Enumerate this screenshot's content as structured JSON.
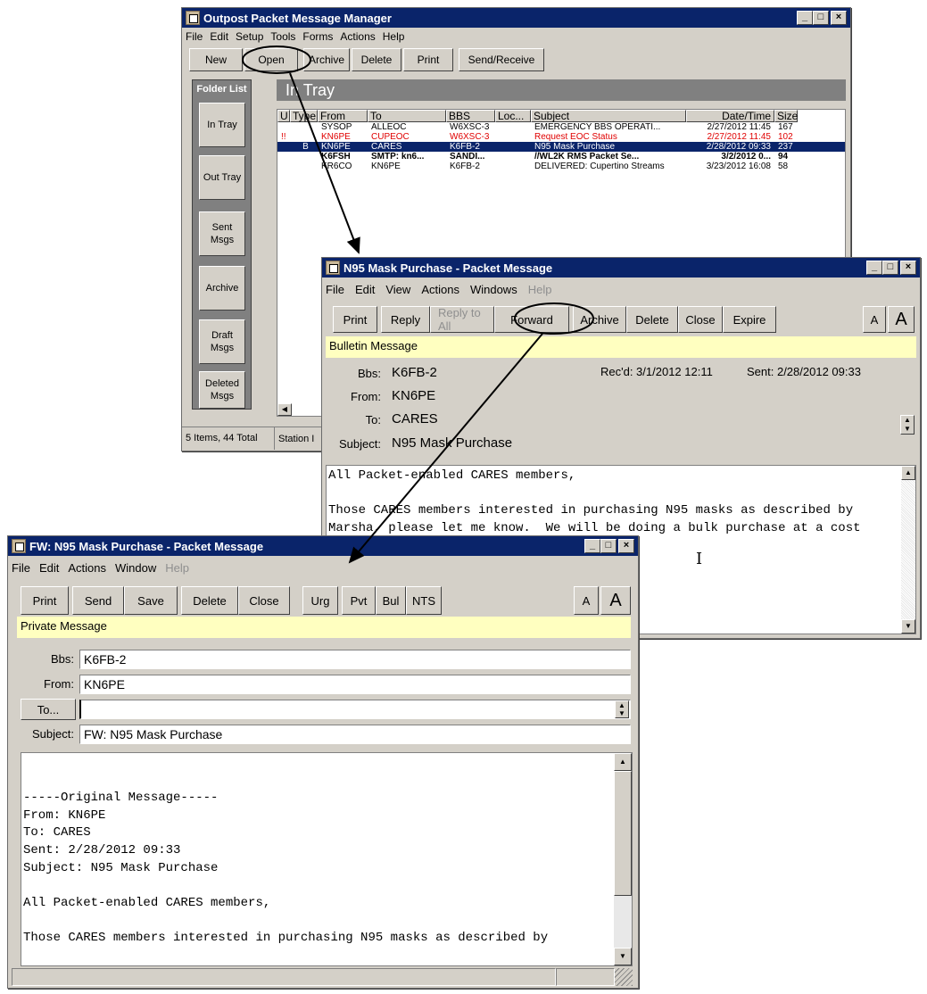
{
  "mgr": {
    "title": "Outpost Packet Message Manager",
    "menu": [
      "File",
      "Edit",
      "Setup",
      "Tools",
      "Forms",
      "Actions",
      "Help"
    ],
    "toolbar": [
      "New",
      "Open",
      "Archive",
      "Delete",
      "Print",
      "Send/Receive"
    ],
    "folder_list_label": "Folder List",
    "folders": [
      "In Tray",
      "Out Tray",
      "Sent Msgs",
      "Archive",
      "Draft Msgs",
      "Deleted Msgs"
    ],
    "tray_title": "In Tray",
    "columns": [
      "U",
      "Type",
      "From",
      "To",
      "BBS",
      "Loc...",
      "Subject",
      "Date/Time",
      "Size"
    ],
    "rows": [
      {
        "u": "",
        "type": "",
        "from": "SYSOP",
        "to": "ALLEOC",
        "bbs": "W6XSC-3",
        "subject": "EMERGENCY BBS OPERATI...",
        "date": "2/27/2012 11:45",
        "size": "167",
        "style": "normal"
      },
      {
        "u": "!!",
        "type": "",
        "from": "KN6PE",
        "to": "CUPEOC",
        "bbs": "W6XSC-3",
        "subject": "Request EOC Status",
        "date": "2/27/2012 11:45",
        "size": "102",
        "style": "red"
      },
      {
        "u": "",
        "type": "B",
        "from": "KN6PE",
        "to": "CARES",
        "bbs": "K6FB-2",
        "subject": "N95 Mask Purchase",
        "date": "2/28/2012 09:33",
        "size": "237",
        "style": "selected"
      },
      {
        "u": "",
        "type": "",
        "from": "K6FSH",
        "to": "SMTP: kn6...",
        "bbs": "SANDI...",
        "subject": "//WL2K RMS Packet Se...",
        "date": "3/2/2012 0...",
        "size": "94",
        "style": "bold"
      },
      {
        "u": "",
        "type": "",
        "from": "KR6CO",
        "to": "KN6PE",
        "bbs": "K6FB-2",
        "subject": "DELIVERED: Cupertino Streams",
        "date": "3/23/2012 16:08",
        "size": "58",
        "style": "normal"
      }
    ],
    "status_items": "5 Items, 44 Total",
    "status_station": "Station I"
  },
  "msg": {
    "title": "N95 Mask Purchase - Packet Message",
    "menu": [
      "File",
      "Edit",
      "View",
      "Actions",
      "Windows"
    ],
    "menu_help": "Help",
    "toolbar": [
      "Print",
      "Reply",
      "Reply to All",
      "Forward",
      "Archive",
      "Delete",
      "Close",
      "Expire"
    ],
    "font_small": "A",
    "font_large": "A",
    "banner": "Bulletin Message",
    "bbs_label": "Bbs:",
    "bbs": "K6FB-2",
    "from_label": "From:",
    "from": "KN6PE",
    "to_label": "To:",
    "to": "CARES",
    "subject_label": "Subject:",
    "subject": "N95 Mask Purchase",
    "recd": "Rec'd:  3/1/2012 12:11",
    "sent": "Sent:  2/28/2012 09:33",
    "body": "All Packet-enabled CARES members,\n\nThose CARES members interested in purchasing N95 masks as described by\nMarsha, please let me know.  We will be doing a bulk purchase at a cost"
  },
  "fw": {
    "title": "FW: N95 Mask Purchase - Packet Message",
    "menu": [
      "File",
      "Edit",
      "Actions",
      "Window"
    ],
    "menu_help": "Help",
    "toolbar": [
      "Print",
      "Send",
      "Save",
      "Delete",
      "Close",
      "Urg",
      "Pvt",
      "Bul",
      "NTS"
    ],
    "font_small": "A",
    "font_large": "A",
    "banner": "Private Message",
    "bbs_label": "Bbs:",
    "bbs": "K6FB-2",
    "from_label": "From:",
    "from": "KN6PE",
    "to_button": "To...",
    "to": "",
    "subject_label": "Subject:",
    "subject": "FW: N95 Mask Purchase",
    "body": "\n\n-----Original Message-----\nFrom: KN6PE\nTo: CARES\nSent: 2/28/2012 09:33\nSubject: N95 Mask Purchase\n\nAll Packet-enabled CARES members,\n\nThose CARES members interested in purchasing N95 masks as described by"
  },
  "colors": {
    "title_bar": "#0a246a",
    "selected_row": "#0a246a",
    "red_text": "#e00000",
    "banner": "#ffffc0"
  }
}
